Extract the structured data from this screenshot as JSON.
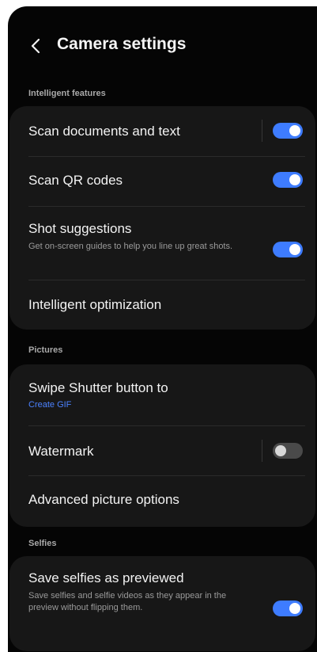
{
  "header": {
    "title": "Camera settings"
  },
  "sections": {
    "intelligent": {
      "label": "Intelligent features",
      "scan_documents": {
        "title": "Scan documents and text",
        "toggle": true
      },
      "scan_qr": {
        "title": "Scan QR codes",
        "toggle": true
      },
      "shot_suggestions": {
        "title": "Shot suggestions",
        "description": "Get on-screen guides to help you line up great shots.",
        "toggle": true
      },
      "intelligent_optimization": {
        "title": "Intelligent optimization"
      }
    },
    "pictures": {
      "label": "Pictures",
      "swipe_shutter": {
        "title": "Swipe Shutter button to",
        "value": "Create GIF"
      },
      "watermark": {
        "title": "Watermark",
        "toggle": false
      },
      "advanced_picture": {
        "title": "Advanced picture options"
      }
    },
    "selfies": {
      "label": "Selfies",
      "save_selfies": {
        "title": "Save selfies as previewed",
        "description": "Save selfies and selfie videos as they appear in the preview without flipping them.",
        "toggle": true
      }
    }
  },
  "colors": {
    "accent": "#3e7cff",
    "link": "#4b82ff",
    "background": "#050505",
    "card": "#171717"
  }
}
